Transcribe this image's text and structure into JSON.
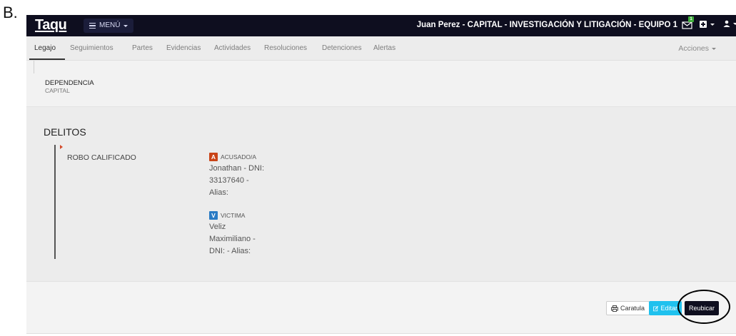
{
  "corner_label": "B.",
  "navbar": {
    "brand": "Taqu",
    "menu_label": "MENÚ",
    "user_title": "Juan Perez - CAPITAL - INVESTIGACIÓN Y LITIGACIÓN - EQUIPO 1",
    "mail_badge_count": "1"
  },
  "tabs": [
    {
      "label": "Legajo",
      "active": true
    },
    {
      "label": "Seguimientos"
    },
    {
      "label": "Partes"
    },
    {
      "label": "Evidencias"
    },
    {
      "label": "Actividades"
    },
    {
      "label": "Resoluciones"
    },
    {
      "label": "Detenciones"
    },
    {
      "label": "Alertas"
    }
  ],
  "acciones_label": "Acciones",
  "dependencia": {
    "label": "DEPENDENCIA",
    "value": "CAPITAL"
  },
  "delitos": {
    "title": "DELITOS",
    "items": [
      {
        "name": "ROBO CALIFICADO",
        "parties": [
          {
            "badge": "A",
            "badge_color": "#c94418",
            "role": "ACUSADO/A",
            "lines": [
              "Jonathan - DNI:",
              "33137640 -",
              "Alias:"
            ]
          },
          {
            "badge": "V",
            "badge_color": "#2a7bc4",
            "role": "VICTIMA",
            "lines": [
              "Veliz",
              "Maximiliano -",
              "DNI: - Alias:"
            ]
          }
        ]
      }
    ]
  },
  "buttons": {
    "caratula": "Caratula",
    "editar": "Editar",
    "reubicar": "Reubicar"
  }
}
